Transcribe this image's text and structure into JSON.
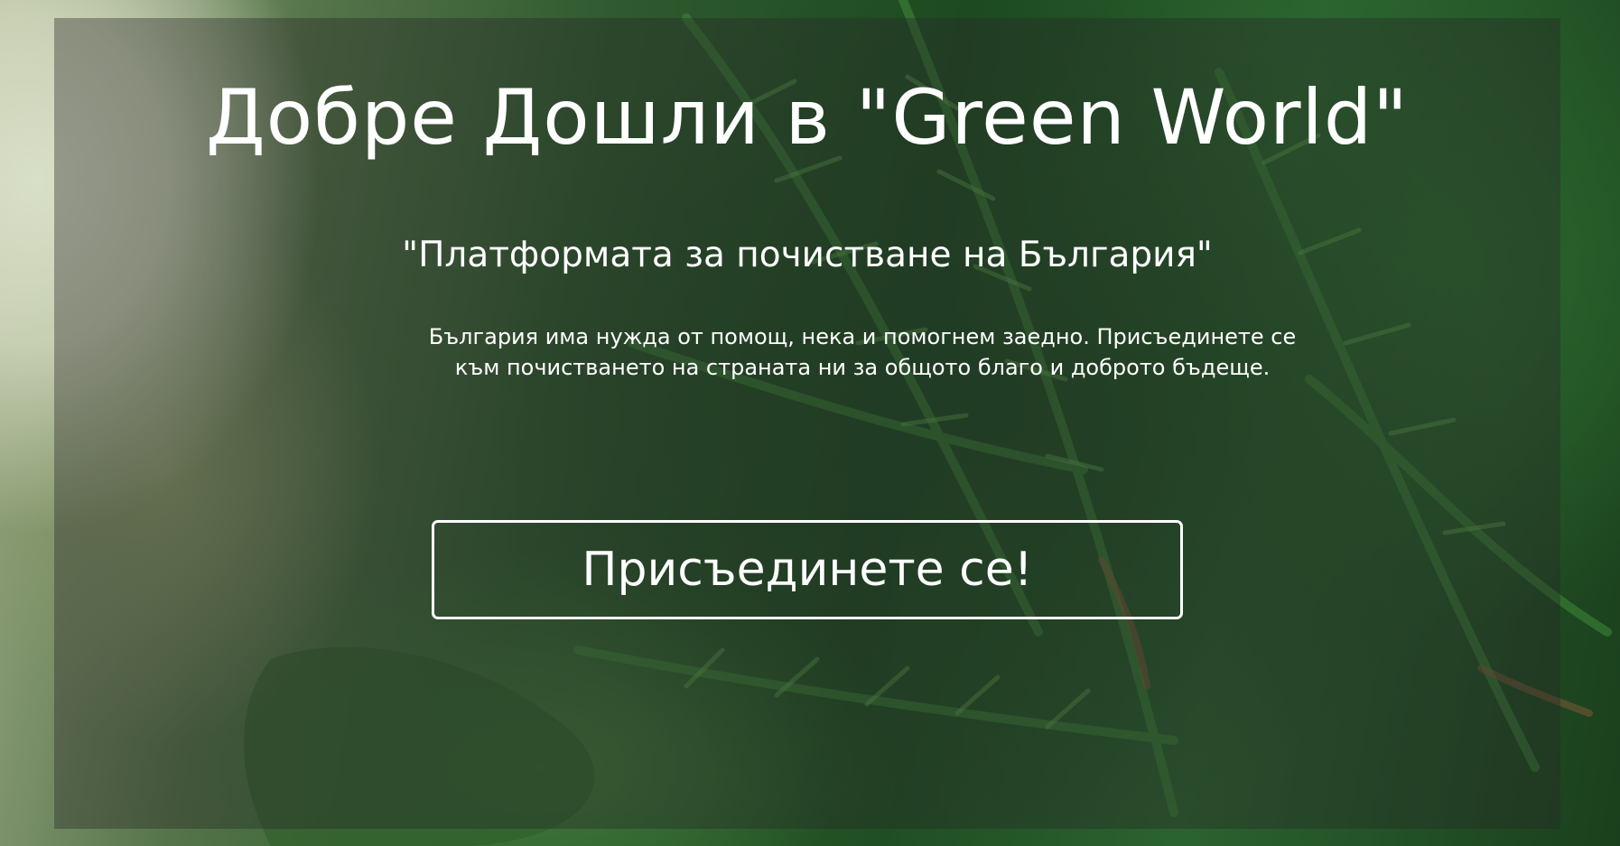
{
  "hero": {
    "title": "Добре Дошли в \"Green World\"",
    "subtitle": "\"Платформата за почистване на България\"",
    "description_line1": "България има нужда от помощ, нека и помогнем заедно. Присъединете се",
    "description_line2": "към почистването на страната ни за общото благо и доброто бъдеще.",
    "button_label": "Присъединете се!"
  }
}
